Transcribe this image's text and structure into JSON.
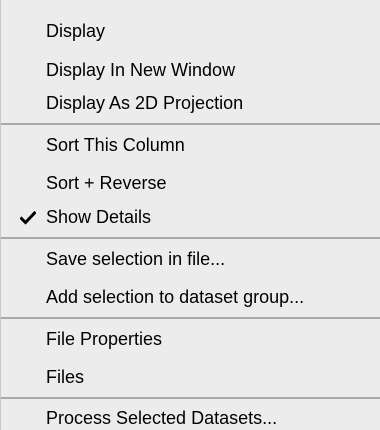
{
  "context_menu": {
    "items": [
      {
        "label": "Display",
        "checked": false
      },
      {
        "label": "Display In New Window",
        "checked": false
      },
      {
        "label": "Display As 2D Projection",
        "checked": false
      },
      {
        "label": "Sort This Column",
        "checked": false
      },
      {
        "label": "Sort + Reverse",
        "checked": false
      },
      {
        "label": "Show Details",
        "checked": true
      },
      {
        "label": "Save selection in file...",
        "checked": false
      },
      {
        "label": "Add selection to dataset group...",
        "checked": false
      },
      {
        "label": "File Properties",
        "checked": false
      },
      {
        "label": "Files",
        "checked": false
      },
      {
        "label": "Process Selected Datasets...",
        "checked": false
      }
    ],
    "check_icon": "checkmark-icon",
    "colors": {
      "background": "#ececec",
      "separator": "#a9a9a9",
      "text": "#000000"
    }
  }
}
